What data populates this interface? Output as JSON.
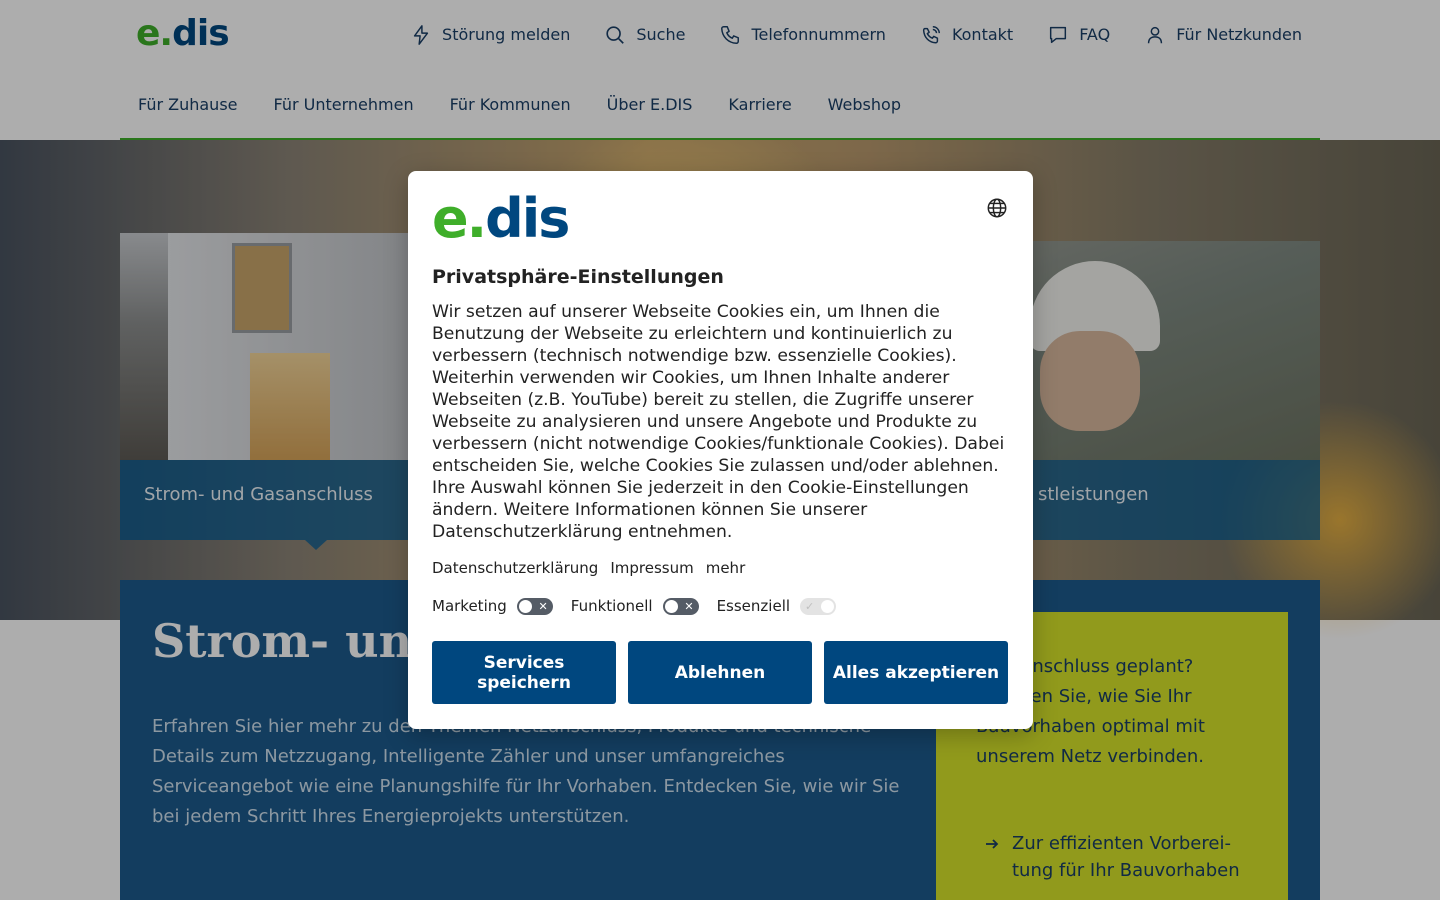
{
  "header": {
    "logo": {
      "e": "e",
      "dot": ".",
      "dis": "dis"
    },
    "utility": [
      {
        "label": "Störung melden",
        "icon": "lightning-icon"
      },
      {
        "label": "Suche",
        "icon": "search-icon"
      },
      {
        "label": "Telefonnummern",
        "icon": "phone-icon"
      },
      {
        "label": "Kontakt",
        "icon": "contact-phone-icon"
      },
      {
        "label": "FAQ",
        "icon": "chat-bubble-icon"
      },
      {
        "label": "Für Netzkunden",
        "icon": "user-icon"
      }
    ],
    "nav": [
      "Für Zuhause",
      "Für Unternehmen",
      "Für Kommunen",
      "Über E.DIS",
      "Karriere",
      "Webshop"
    ]
  },
  "hero": {
    "cards": [
      {
        "label": "Strom- und Gasanschluss"
      },
      {
        "label": "stleistungen"
      }
    ]
  },
  "content": {
    "title": "Strom- und",
    "text": "Erfahren Sie hier mehr zu den Themen Netzanschluss, Produkte und technische Details zum Netzzugang, Intelligente Zähler und unser umfangreiches Serviceangebot wie eine Planungshilfe für Ihr Vorhaben. Entdecken Sie, wie wir Sie bei jedem Schritt Ihres Ener­gieprojekts unterstützen.",
    "side": {
      "text": "Hausanschluss geplant? Erfahren Sie, wie Sie Ihr Bauvorhaben optimal mit unserem Netz verbinden.",
      "link": "Zur effizienten Vorberei­tung für Ihr Bauvorhaben"
    }
  },
  "modal": {
    "logo": {
      "e": "e",
      "dot": ".",
      "dis": "dis"
    },
    "title": "Privatsphäre-Einstellungen",
    "description": "Wir setzen auf unserer Webseite Cookies ein, um Ihnen die Benutzung der Webseite zu erleichtern und kontinuierlich zu verbessern (technisch notwendige bzw. essenzielle Cookies). Weiterhin verwenden wir Cookies, um Ihnen Inhalte anderer Webseiten (z.B. YouTube) bereit zu stellen, die Zugriffe unserer Webseite zu analysieren und unsere Angebote und Produkte zu verbessern (nicht notwendige Cookies/funktionale Cookies). Dabei entscheiden Sie, welche Cookies Sie zulassen und/oder ablehnen. Ihre Auswahl können Sie jederzeit in den Cookie-Einstellungen ändern. Weitere Informationen können Sie unserer Datenschutzerklärung entnehmen.",
    "links": [
      "Datenschutzerklärung",
      "Impressum",
      "mehr"
    ],
    "toggles": [
      {
        "label": "Marketing",
        "state": "off"
      },
      {
        "label": "Funktionell",
        "state": "off"
      },
      {
        "label": "Essenziell",
        "state": "on-disabled"
      }
    ],
    "buttons": {
      "save": "Services speichern",
      "reject": "Ablehnen",
      "accept": "Alles akzeptieren"
    }
  },
  "colors": {
    "brand_green": "#3fae2a",
    "brand_blue": "#00477f",
    "accent_yellow": "#d6e32a"
  }
}
